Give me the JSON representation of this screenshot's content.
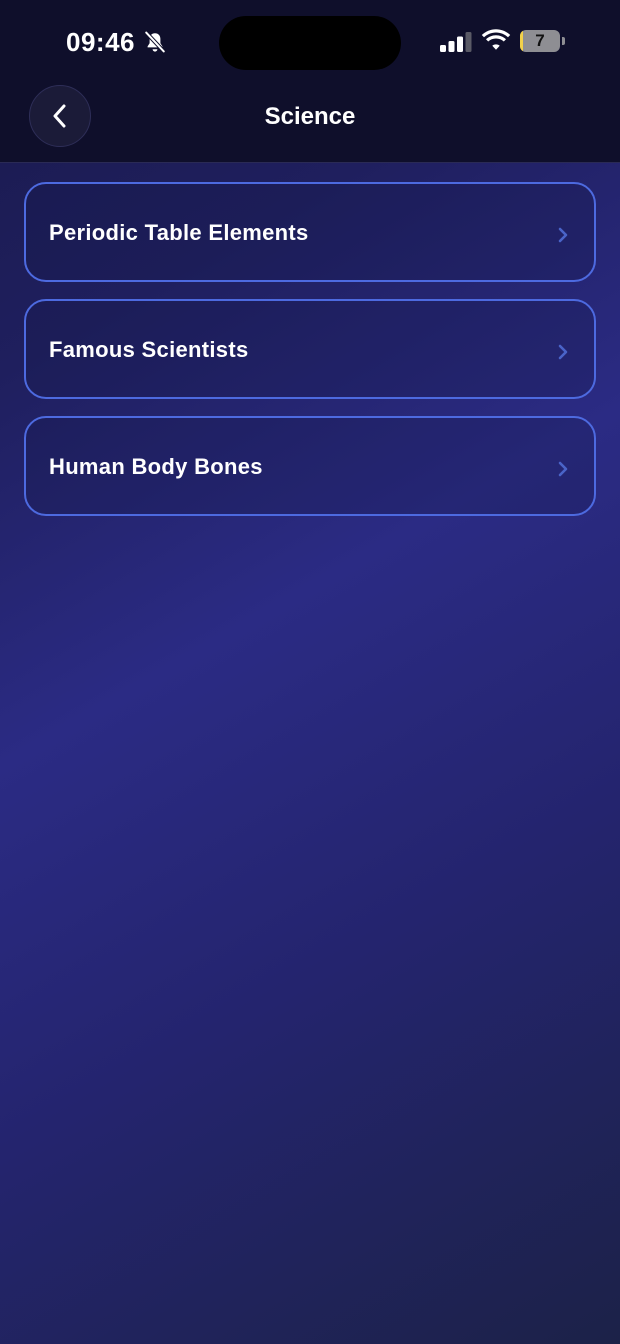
{
  "status_bar": {
    "time": "09:46",
    "battery_level": "7",
    "battery_fraction": 0.07,
    "icons": [
      "bell-slash-icon",
      "cellular-signal-icon",
      "wifi-icon",
      "battery-icon"
    ]
  },
  "nav": {
    "title": "Science",
    "back_icon": "chevron-left-icon"
  },
  "topics": [
    {
      "label": "Periodic Table Elements",
      "icon": "chevron-right-icon"
    },
    {
      "label": "Famous Scientists",
      "icon": "chevron-right-icon"
    },
    {
      "label": "Human Body Bones",
      "icon": "chevron-right-icon"
    }
  ],
  "colors": {
    "header_bg": "#0f0f2b",
    "card_border": "#4d6ae0",
    "chevron": "#4a64c8",
    "battery_fill": "#f2d14a"
  }
}
